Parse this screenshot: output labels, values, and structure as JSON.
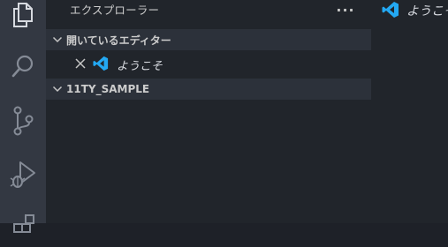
{
  "activity_bar": {
    "items": [
      {
        "name": "explorer-icon",
        "active": true
      },
      {
        "name": "search-icon",
        "active": false
      },
      {
        "name": "source-control-icon",
        "active": false
      },
      {
        "name": "run-debug-icon",
        "active": false
      },
      {
        "name": "extensions-icon",
        "active": false
      }
    ]
  },
  "sidebar": {
    "title": "エクスプローラー",
    "more_label": "···",
    "open_editors": {
      "label": "開いているエディター",
      "items": [
        {
          "label": "ようこそ",
          "icon": "vscode-icon"
        }
      ]
    },
    "folder": {
      "label": "11TY_SAMPLE"
    }
  },
  "editor": {
    "tab_label": "ようこそ"
  },
  "colors": {
    "activity_bar": "#333842",
    "sidebar": "#21252b",
    "section_header": "#2c313a",
    "accent_blue": "#23a8f2"
  }
}
